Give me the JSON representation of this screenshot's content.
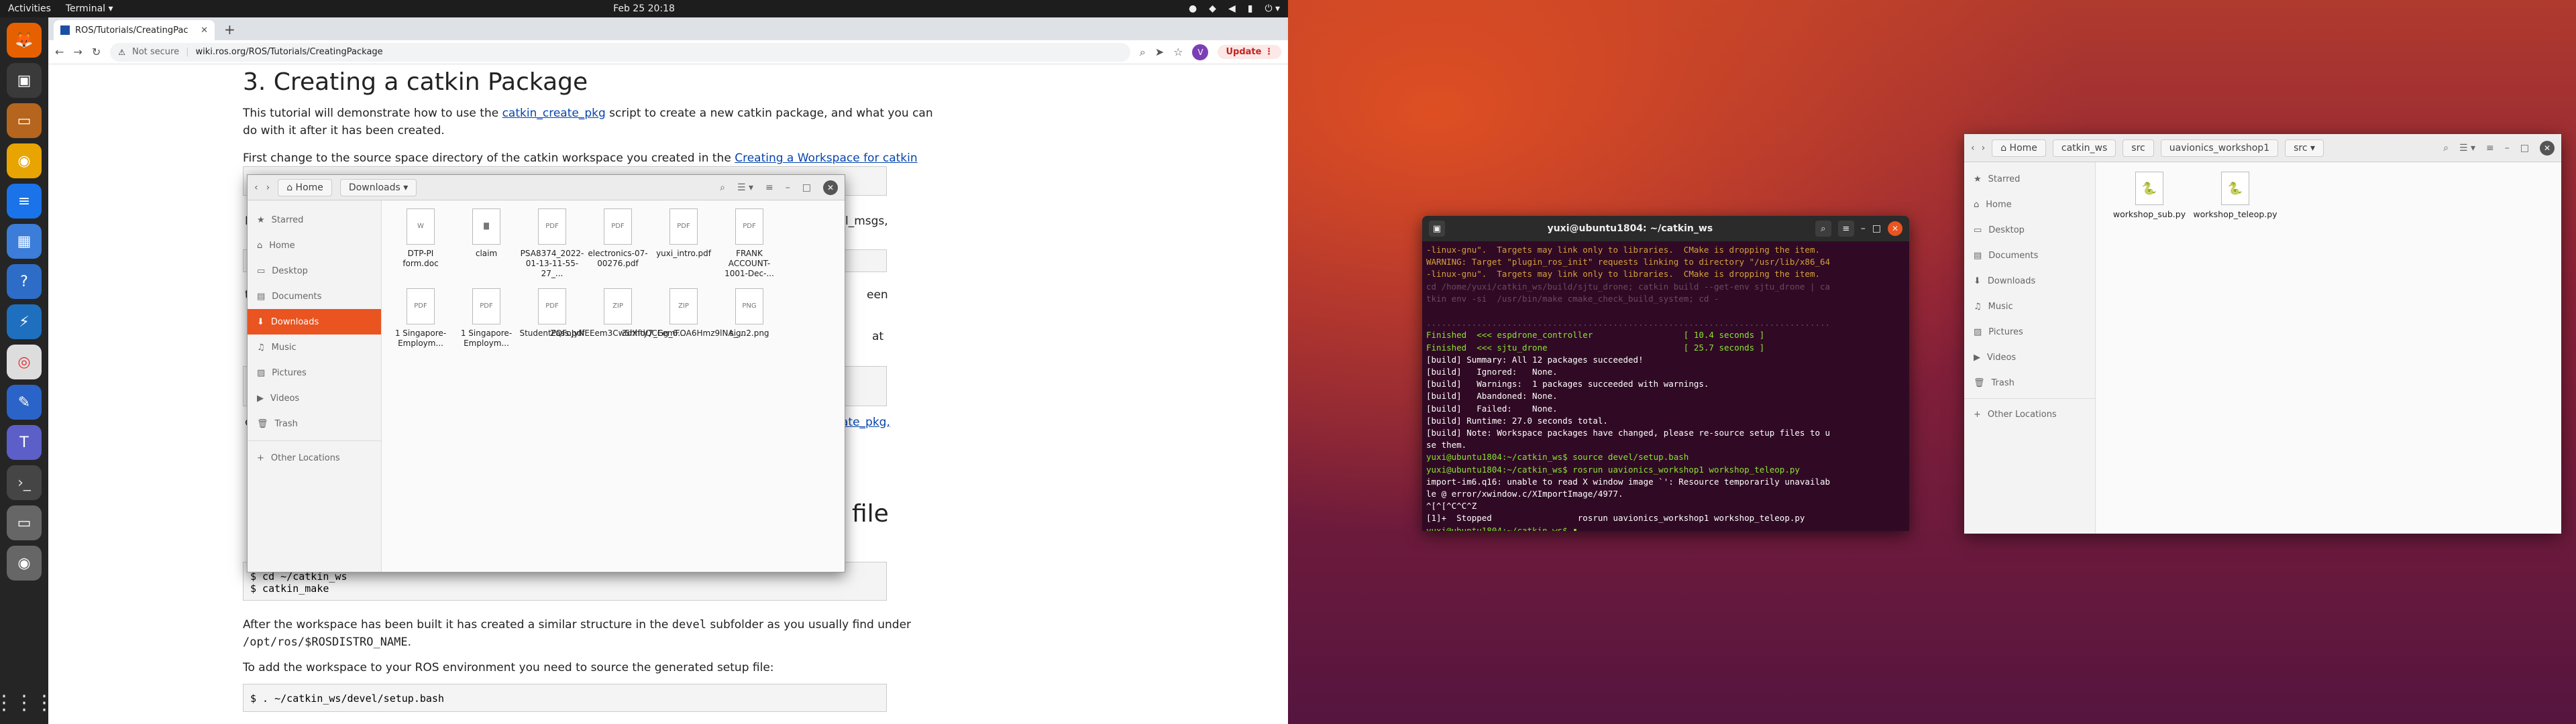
{
  "topbar": {
    "activities": "Activities",
    "app": "Terminal ▾",
    "clock": "Feb 25  20:18",
    "icons": [
      "●",
      "◆",
      "◀",
      "▮",
      "⏻ ▾"
    ]
  },
  "dock": {
    "apps": [
      "🦊",
      "▣",
      "▭",
      "◉",
      "≡",
      "▦",
      "?",
      "⚡",
      "◎",
      "✎",
      "T",
      "›_",
      "▭",
      "◉"
    ],
    "grid": "⋮⋮⋮"
  },
  "browser": {
    "tab_title": "ROS/Tutorials/CreatingPac",
    "tab_close": "✕",
    "new_tab": "+",
    "not_secure": "Not secure",
    "url": "wiki.ros.org/ROS/Tutorials/CreatingPackage",
    "avatar": "V",
    "update": "Update",
    "nav": {
      "back": "←",
      "forward": "→",
      "reload": "↻",
      "zoom": "⌕",
      "share": "➤",
      "star": "☆"
    }
  },
  "page": {
    "h1": "3. Creating a catkin Package",
    "p1_pre": "This tutorial will demonstrate how to use the ",
    "p1_link": "catkin_create_pkg",
    "p1_post": " script to create a new catkin package, and what you can do with it after it has been created.",
    "p2_pre": "First change to the source space directory of the catkin workspace you created in the ",
    "p2_link": "Creating a Workspace for catkin",
    "frag_msgs": "l_msgs,",
    "frag_een": "een",
    "frag_at": "at",
    "frag_pkg": "ate_pkg,",
    "frag_r": "r",
    "frag_c": "c",
    "frag_t": "t",
    "frag_n": "N",
    "h2_tail": "file",
    "code1_line1": "$ cd ~/catkin_ws",
    "code1_line2": "$ catkin_make",
    "p3_pre": "After the workspace has been built it has created a similar structure in the ",
    "p3_code": "devel",
    "p3_post": " subfolder as you usually find under",
    "p3_path": "/opt/ros/$ROSDISTRO_NAME",
    "p3_end": ".",
    "p4": "To add the workspace to your ROS environment you need to source the generated setup file:",
    "code2": "$ . ~/catkin_ws/devel/setup.bash"
  },
  "fm_downloads": {
    "nav": [
      "‹",
      "›"
    ],
    "home": "⌂ Home",
    "current": "Downloads",
    "header_icons": [
      "⌕",
      "☰ ▾",
      "≡",
      "–",
      "□"
    ],
    "close": "✕",
    "sidebar": [
      {
        "icon": "★",
        "label": "Starred"
      },
      {
        "icon": "⌂",
        "label": "Home"
      },
      {
        "icon": "▭",
        "label": "Desktop"
      },
      {
        "icon": "▤",
        "label": "Documents"
      },
      {
        "icon": "⬇",
        "label": "Downloads"
      },
      {
        "icon": "♫",
        "label": "Music"
      },
      {
        "icon": "▨",
        "label": "Pictures"
      },
      {
        "icon": "▶",
        "label": "Videos"
      },
      {
        "icon": "🗑",
        "label": "Trash"
      },
      {
        "icon": "+",
        "label": "Other Locations"
      }
    ],
    "files": [
      {
        "icon": "W",
        "name": "DTP-PI form.doc"
      },
      {
        "icon": "▇",
        "name": "claim"
      },
      {
        "icon": "PDF",
        "name": "PSA8374_2022-01-13-11-55-27_..."
      },
      {
        "icon": "PDF",
        "name": "electronics-07-00276.pdf"
      },
      {
        "icon": "PDF",
        "name": "yuxi_intro.pdf"
      },
      {
        "icon": "PDF",
        "name": "FRANK ACCOUNT-1001-Dec-..."
      },
      {
        "icon": "PDF",
        "name": "1 Singapore-Employm..."
      },
      {
        "icon": "PDF",
        "name": "1 Singapore-Employm..."
      },
      {
        "icon": "PDF",
        "name": "StudentPass.pdf"
      },
      {
        "icon": "ZIP",
        "name": "ZQFoJyNEEem3Cw5hhdQCGg_6..."
      },
      {
        "icon": "ZIP",
        "name": "3dXfty7_EemFOA6Hmz9lNA_..."
      },
      {
        "icon": "PNG",
        "name": "sign2.png"
      }
    ]
  },
  "terminal": {
    "title": "yuxi@ubuntu1804: ~/catkin_ws",
    "buttons": [
      "▣",
      "⌕",
      "≡",
      "–",
      "□"
    ],
    "close": "✕",
    "lines": [
      {
        "cls": "o",
        "text": "-linux-gnu\".  Targets may link only to libraries.  CMake is dropping the item."
      },
      {
        "cls": "o",
        "text": "WARNING: Target \"plugin_ros_init\" requests linking to directory \"/usr/lib/x86_64"
      },
      {
        "cls": "o",
        "text": "-linux-gnu\".  Targets may link only to libraries.  CMake is dropping the item."
      },
      {
        "cls": "dim",
        "text": "cd /home/yuxi/catkin_ws/build/sjtu_drone; catkin build --get-env sjtu_drone | ca"
      },
      {
        "cls": "dim",
        "text": "tkin env -si  /usr/bin/make cmake_check_build_system; cd -"
      },
      {
        "cls": "",
        "text": " "
      },
      {
        "cls": "dim",
        "text": "................................................................................"
      },
      {
        "cls": "g",
        "text": "Finished  <<< espdrone_controller                  [ 10.4 seconds ]"
      },
      {
        "cls": "g",
        "text": "Finished  <<< sjtu_drone                           [ 25.7 seconds ]"
      },
      {
        "cls": "",
        "text": "[build] Summary: All 12 packages succeeded!"
      },
      {
        "cls": "",
        "text": "[build]   Ignored:   None."
      },
      {
        "cls": "",
        "text": "[build]   Warnings:  1 packages succeeded with warnings."
      },
      {
        "cls": "",
        "text": "[build]   Abandoned: None."
      },
      {
        "cls": "",
        "text": "[build]   Failed:    None."
      },
      {
        "cls": "",
        "text": "[build] Runtime: 27.0 seconds total."
      },
      {
        "cls": "",
        "text": "[build] Note: Workspace packages have changed, please re-source setup files to u"
      },
      {
        "cls": "",
        "text": "se them."
      },
      {
        "cls": "p",
        "text": "yuxi@ubuntu1804:~/catkin_ws$ source devel/setup.bash"
      },
      {
        "cls": "p",
        "text": "yuxi@ubuntu1804:~/catkin_ws$ rosrun uavionics_workshop1 workshop_teleop.py"
      },
      {
        "cls": "",
        "text": "import-im6.q16: unable to read X window image `': Resource temporarily unavailab"
      },
      {
        "cls": "",
        "text": "le @ error/xwindow.c/XImportImage/4977."
      },
      {
        "cls": "",
        "text": "^[^[^C^C^Z"
      },
      {
        "cls": "",
        "text": "[1]+  Stopped                 rosrun uavionics_workshop1 workshop_teleop.py"
      },
      {
        "cls": "p",
        "text": "yuxi@ubuntu1804:~/catkin_ws$ ▮"
      }
    ]
  },
  "fm_src": {
    "nav": [
      "‹",
      "›"
    ],
    "path": [
      "⌂ Home",
      "catkin_ws",
      "src",
      "uavionics_workshop1",
      "src ▾"
    ],
    "header_icons": [
      "⌕",
      "☰ ▾",
      "≡",
      "–",
      "□"
    ],
    "close": "✕",
    "sidebar": [
      {
        "icon": "★",
        "label": "Starred"
      },
      {
        "icon": "⌂",
        "label": "Home"
      },
      {
        "icon": "▭",
        "label": "Desktop"
      },
      {
        "icon": "▤",
        "label": "Documents"
      },
      {
        "icon": "⬇",
        "label": "Downloads"
      },
      {
        "icon": "♫",
        "label": "Music"
      },
      {
        "icon": "▨",
        "label": "Pictures"
      },
      {
        "icon": "▶",
        "label": "Videos"
      },
      {
        "icon": "🗑",
        "label": "Trash"
      },
      {
        "icon": "+",
        "label": "Other Locations"
      }
    ],
    "files": [
      {
        "icon": "🐍",
        "name": "workshop_sub.py"
      },
      {
        "icon": "🐍",
        "name": "workshop_teleop.py"
      }
    ]
  }
}
